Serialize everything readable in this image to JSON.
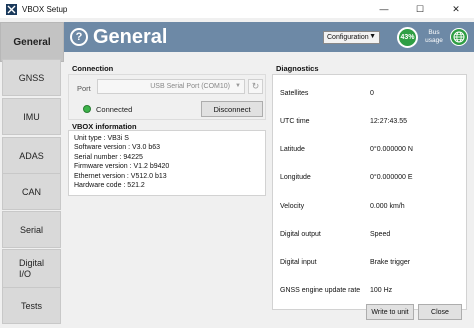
{
  "window": {
    "title": "VBOX Setup",
    "minimize_glyph": "—",
    "maximize_glyph": "☐",
    "close_glyph": "✕"
  },
  "sidebar": {
    "items": [
      {
        "label": "General",
        "active": true
      },
      {
        "label": "GNSS"
      },
      {
        "label": "IMU"
      },
      {
        "label": "ADAS"
      },
      {
        "label": "CAN"
      },
      {
        "label": "Serial"
      },
      {
        "label": "Digital I/O",
        "line1": "Digital",
        "line2": "I/O"
      },
      {
        "label": "Tests"
      }
    ]
  },
  "header": {
    "title": "General",
    "help_glyph": "?",
    "configuration_label": "Configuration",
    "bus_usage_value": "43%",
    "bus_usage_label_line1": "Bus",
    "bus_usage_label_line2": "usage",
    "color": "#6d89a6"
  },
  "connection": {
    "title": "Connection",
    "port_label": "Port",
    "port_value": "USB Serial Port (COM10)",
    "status": "Connected",
    "status_color": "#3cb34a",
    "disconnect_label": "Disconnect"
  },
  "vbox_info": {
    "title": "VBOX information",
    "lines": [
      "Unit type : VB3i S",
      "Software version : V3.0 b63",
      "Serial number : 94225",
      "Firmware version : V1.2 b9420",
      "Ethernet version : V512.0 b13",
      "Hardware code : 521.2"
    ]
  },
  "diagnostics": {
    "title": "Diagnostics",
    "rows": [
      {
        "label": "Satellites",
        "value": "0"
      },
      {
        "label": "UTC time",
        "value": "12:27:43.55"
      },
      {
        "label": "Latitude",
        "value": "0°0.000000 N"
      },
      {
        "label": "Longitude",
        "value": "0°0.000000 E"
      },
      {
        "label": "Velocity",
        "value": "0.000 km/h"
      },
      {
        "label": "Digital output",
        "value": "Speed"
      },
      {
        "label": "Digital input",
        "value": "Brake trigger"
      },
      {
        "label": "GNSS engine update rate",
        "value": "100 Hz"
      }
    ]
  },
  "footer": {
    "write_label": "Write to unit",
    "close_label": "Close"
  }
}
